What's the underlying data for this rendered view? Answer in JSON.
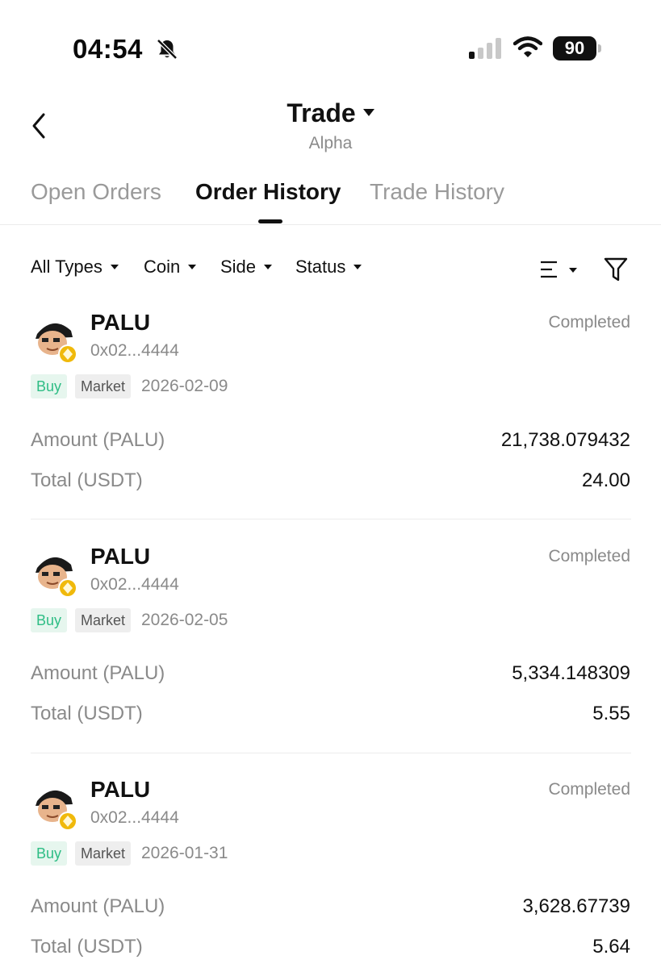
{
  "status_bar": {
    "time": "04:54",
    "battery": "90",
    "icons": [
      "bell-muted-icon",
      "signal-icon",
      "wifi-icon",
      "battery-icon"
    ]
  },
  "header": {
    "back_icon": "chevron-left-icon",
    "title": "Trade",
    "subtitle": "Alpha"
  },
  "tabs": [
    {
      "label": "Open Orders",
      "active": false
    },
    {
      "label": "Order History",
      "active": true
    },
    {
      "label": "Trade History",
      "active": false
    }
  ],
  "filters": [
    {
      "label": "All Types"
    },
    {
      "label": "Coin"
    },
    {
      "label": "Side"
    },
    {
      "label": "Status"
    }
  ],
  "toolbar_icons": [
    "sort-lines-icon",
    "funnel-icon"
  ],
  "colors": {
    "buy_green": "#2ebd85",
    "buy_bg": "#e6f6ee",
    "muted_text": "#8a8a8a",
    "badge_yellow": "#f0b90b"
  },
  "orders": [
    {
      "coin": "PALU",
      "address": "0x02...4444",
      "status": "Completed",
      "side": "Buy",
      "type": "Market",
      "date": "2026-02-09",
      "amount_label": "Amount (PALU)",
      "amount": "21,738.079432",
      "total_label": "Total (USDT)",
      "total": "24.00"
    },
    {
      "coin": "PALU",
      "address": "0x02...4444",
      "status": "Completed",
      "side": "Buy",
      "type": "Market",
      "date": "2026-02-05",
      "amount_label": "Amount (PALU)",
      "amount": "5,334.148309",
      "total_label": "Total (USDT)",
      "total": "5.55"
    },
    {
      "coin": "PALU",
      "address": "0x02...4444",
      "status": "Completed",
      "side": "Buy",
      "type": "Market",
      "date": "2026-01-31",
      "amount_label": "Amount (PALU)",
      "amount": "3,628.67739",
      "total_label": "Total (USDT)",
      "total": "5.64"
    }
  ]
}
